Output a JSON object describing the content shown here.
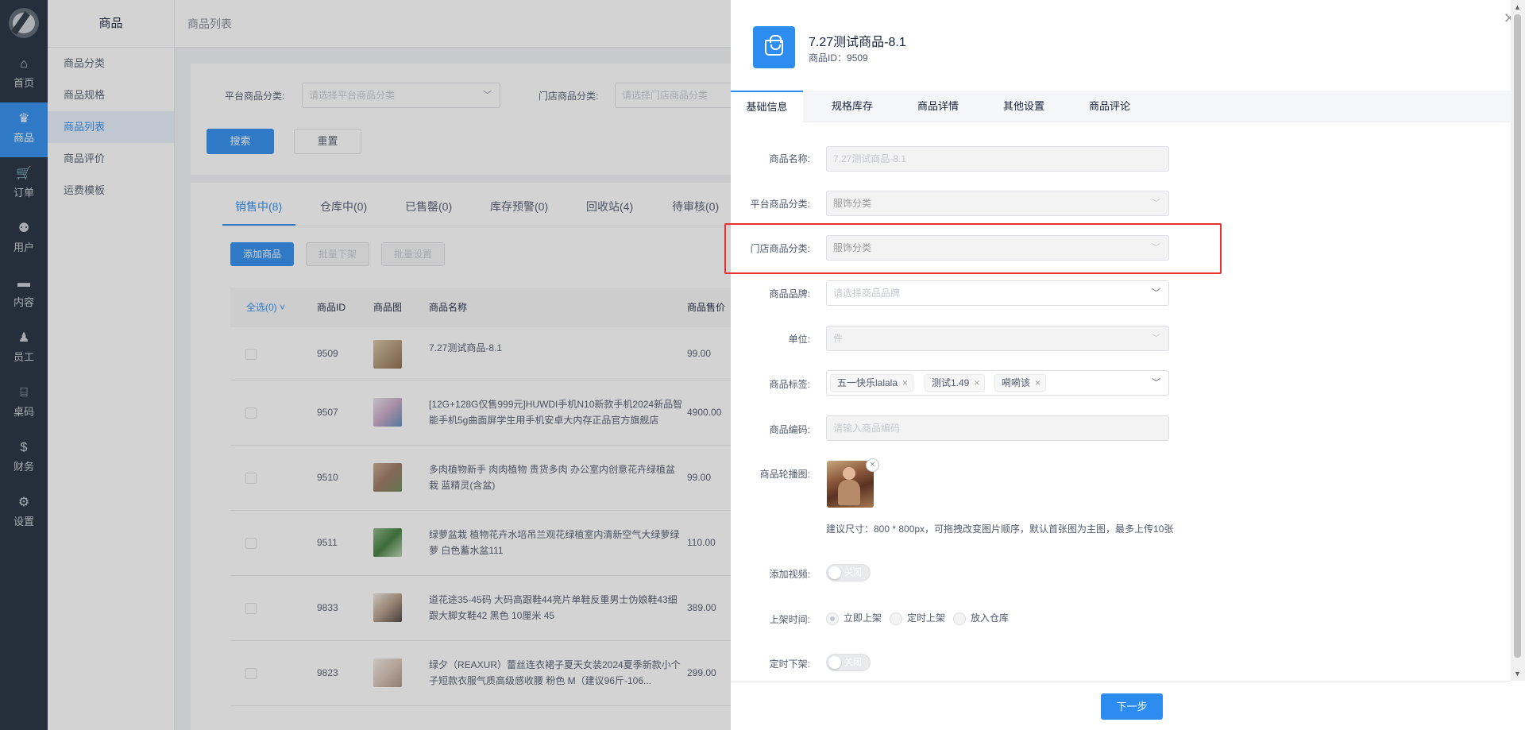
{
  "nav": {
    "items": [
      {
        "label": "首页",
        "icon": "home-icon",
        "glyph": "⌂"
      },
      {
        "label": "商品",
        "icon": "goods-icon",
        "glyph": "♛"
      },
      {
        "label": "订单",
        "icon": "cart-icon",
        "glyph": "🛒"
      },
      {
        "label": "用户",
        "icon": "users-icon",
        "glyph": "⚉"
      },
      {
        "label": "内容",
        "icon": "content-icon",
        "glyph": "▬"
      },
      {
        "label": "员工",
        "icon": "staff-icon",
        "glyph": "♟"
      },
      {
        "label": "桌码",
        "icon": "table-code-icon",
        "glyph": "⌸"
      },
      {
        "label": "财务",
        "icon": "finance-icon",
        "glyph": "$"
      },
      {
        "label": "设置",
        "icon": "settings-icon",
        "glyph": "⚙"
      }
    ]
  },
  "submenu": {
    "title": "商品",
    "items": [
      "商品分类",
      "商品规格",
      "商品列表",
      "商品评价",
      "运费模板"
    ]
  },
  "page": {
    "title": "商品列表",
    "filters": {
      "platform_label": "平台商品分类:",
      "platform_placeholder": "请选择平台商品分类",
      "store_label": "门店商品分类:",
      "store_placeholder": "请选择门店商品分类"
    },
    "search_button": "搜索",
    "reset_button": "重置",
    "tabs": [
      "销售中(8)",
      "仓库中(0)",
      "已售罄(0)",
      "库存预警(0)",
      "回收站(4)",
      "待审核(0)"
    ],
    "actions": {
      "add": "添加商品",
      "batch_off": "批量下架",
      "batch_set": "批量设置"
    },
    "columns": {
      "select_all": "全选(0)",
      "id": "商品ID",
      "image": "商品图",
      "name": "商品名称",
      "price": "商品售价"
    },
    "rows": [
      {
        "id": "9509",
        "name": "7.27测试商品-8.1",
        "price": "99.00"
      },
      {
        "id": "9507",
        "name": "[12G+128G仅售999元]HUWDI手机N10新款手机2024新品智能手机5g曲面屏学生用手机安卓大内存正品官方旗舰店",
        "price": "4900.00"
      },
      {
        "id": "9510",
        "name": "多肉植物新手 肉肉植物 贵货多肉 办公室内创意花卉绿植盆栽 蓝精灵(含盆)",
        "price": "99.00"
      },
      {
        "id": "9511",
        "name": "绿萝盆栽 植物花卉水培吊兰观花绿植室内清新空气大绿萝绿萝 白色蓄水盆111",
        "price": "110.00"
      },
      {
        "id": "9833",
        "name": "道花途35-45码 大码高跟鞋44亮片单鞋反重男士伪娘鞋43细跟大脚女鞋42 黑色 10厘米 45",
        "price": "389.00"
      },
      {
        "id": "9823",
        "name": "绿夕（REAXUR）蕾丝连衣裙子夏天女装2024夏季新款小个子短款衣服气质高级感收腰 粉色 M（建议96斤-106...",
        "price": "299.00"
      }
    ]
  },
  "drawer": {
    "product_title": "7.27测试商品-8.1",
    "product_id_label": "商品ID：",
    "product_id": "9509",
    "tabs": [
      "基础信息",
      "规格库存",
      "商品详情",
      "其他设置",
      "商品评论"
    ],
    "form": {
      "name_label": "商品名称:",
      "name_value": "7.27测试商品-8.1",
      "platform_cat_label": "平台商品分类:",
      "platform_cat_value": "服饰分类",
      "store_cat_label": "门店商品分类:",
      "store_cat_value": "服饰分类",
      "brand_label": "商品品牌:",
      "brand_placeholder": "请选择商品品牌",
      "unit_label": "单位:",
      "unit_value": "件",
      "tags_label": "商品标签:",
      "tags": [
        "五一快乐lalala",
        "测试1.49",
        "嗬嗬该"
      ],
      "code_label": "商品编码:",
      "code_placeholder": "请输入商品编码",
      "images_label": "商品轮播图:",
      "images_hint": "建议尺寸：800 * 800px，可拖拽改变图片顺序，默认首张图为主图，最多上传10张",
      "video_label": "添加视频:",
      "video_switch": "关闭",
      "shelf_label": "上架时间:",
      "shelf_options": [
        "立即上架",
        "定时上架",
        "放入仓库"
      ],
      "shelf_selected": "立即上架",
      "offshelf_label": "定时下架:",
      "offshelf_switch": "关闭"
    },
    "next_button": "下一步",
    "close_glyph": "✕"
  },
  "colors": {
    "primary": "#2d8cf0",
    "nav_bg": "#1f2d3d",
    "highlight": "#e83030"
  }
}
